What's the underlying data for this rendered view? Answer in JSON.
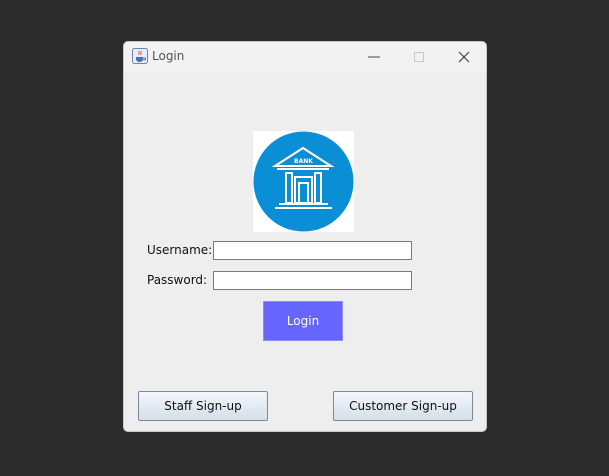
{
  "window": {
    "title": "Login",
    "icon": "java-cup-icon"
  },
  "titlebar": {
    "minimize_icon": "minimize-icon",
    "maximize_icon": "maximize-icon",
    "close_icon": "close-icon"
  },
  "logo": {
    "icon": "bank-building-icon",
    "text": "BANK",
    "color": "#0a8fd6"
  },
  "form": {
    "username_label": "Username:",
    "password_label": "Password:",
    "username_value": "",
    "password_value": ""
  },
  "buttons": {
    "login_label": "Login",
    "login_color": "#6666ff",
    "staff_signup_label": "Staff Sign-up",
    "customer_signup_label": "Customer Sign-up"
  }
}
